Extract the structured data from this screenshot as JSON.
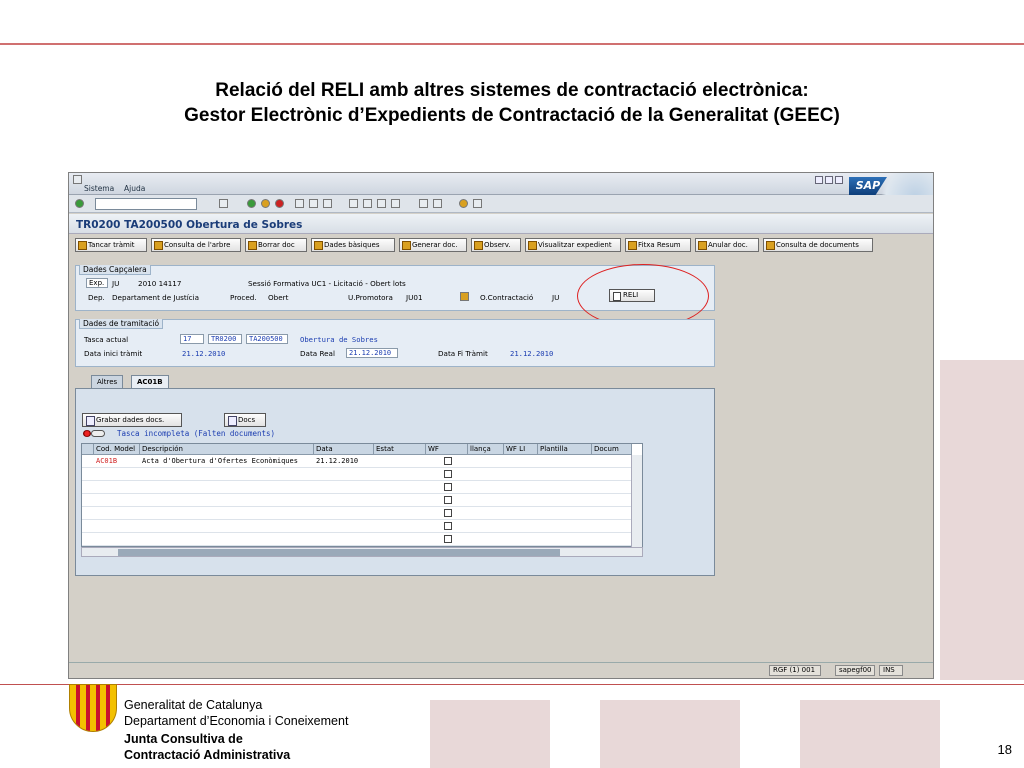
{
  "slide": {
    "title_line1": "Relació del RELI amb altres sistemes de contractació electrònica:",
    "title_line2": "Gestor Electrònic d’Expedients de Contractació de la Generalitat (GEEC)",
    "page_number": "18",
    "footer": {
      "org": "Generalitat de Catalunya",
      "dept": "Departament d’Economia i Coneixement",
      "unit1": "Junta Consultiva de",
      "unit2": "Contractació Administrativa"
    },
    "colors": {
      "rule": "#d07070",
      "ellipse": "#dd2222"
    }
  },
  "sap": {
    "menu": [
      "Sistema",
      "Ajuda"
    ],
    "logo": "SAP",
    "screen_title": "TR0200 TA200500 Obertura de Sobres",
    "app_toolbar": [
      "Tancar tràmit",
      "Consulta de l'arbre",
      "Borrar doc",
      "Dades bàsiques",
      "Generar doc.",
      "Observ.",
      "Visualitzar expedient",
      "Fitxa Resum",
      "Anular doc.",
      "Consulta de documents"
    ],
    "dades_capcalera": {
      "title": "Dades Capçalera",
      "exp_label": "Exp.",
      "exp_value1": "JU",
      "exp_value2": "2010 14117",
      "description": "Sessió Formativa UC1 - Licitació - Obert lots",
      "dep_label": "Dep.",
      "dep_value": "Departament de Justícia",
      "proced_label": "Proced.",
      "proced_value": "Obert",
      "promotora_label": "U.Promotora",
      "promotora_value": "JU01",
      "contractacio_label": "O.Contractació",
      "contractacio_value": "JU",
      "reli_button": "RELI"
    },
    "dades_tramitacio": {
      "title": "Dades de tramitació",
      "tasca_label": "Tasca actual",
      "tasca_num": "17",
      "tasca_code1": "TR0200",
      "tasca_code2": "TA200500",
      "tasca_name": "Obertura de Sobres",
      "inici_label": "Data inici tràmit",
      "inici_value": "21.12.2010",
      "real_label": "Data Real",
      "real_value": "21.12.2010",
      "fi_label": "Data Fi Tràmit",
      "fi_value": "21.12.2010"
    },
    "tabs": [
      "Altres",
      "AC01B"
    ],
    "tab_buttons": [
      "Grabar dades docs.",
      "Docs"
    ],
    "status_text": "Tasca incompleta (Falten documents)",
    "table": {
      "columns": [
        "Cod. Model",
        "Descripción",
        "Data",
        "Estat",
        "WF",
        "llança",
        "WF LI",
        "Plantilla",
        "Docum"
      ],
      "rows": [
        {
          "cod": "AC01B",
          "desc": "Acta d'Obertura d'Ofertes Econòmiques",
          "data": "21.12.2010"
        },
        {
          "cod": "",
          "desc": "",
          "data": ""
        },
        {
          "cod": "",
          "desc": "",
          "data": ""
        },
        {
          "cod": "",
          "desc": "",
          "data": ""
        },
        {
          "cod": "",
          "desc": "",
          "data": ""
        },
        {
          "cod": "",
          "desc": "",
          "data": ""
        },
        {
          "cod": "",
          "desc": "",
          "data": ""
        }
      ]
    },
    "statusbar": {
      "system": "RGF (1) 001",
      "server": "sapegf00",
      "mode": "INS"
    }
  }
}
